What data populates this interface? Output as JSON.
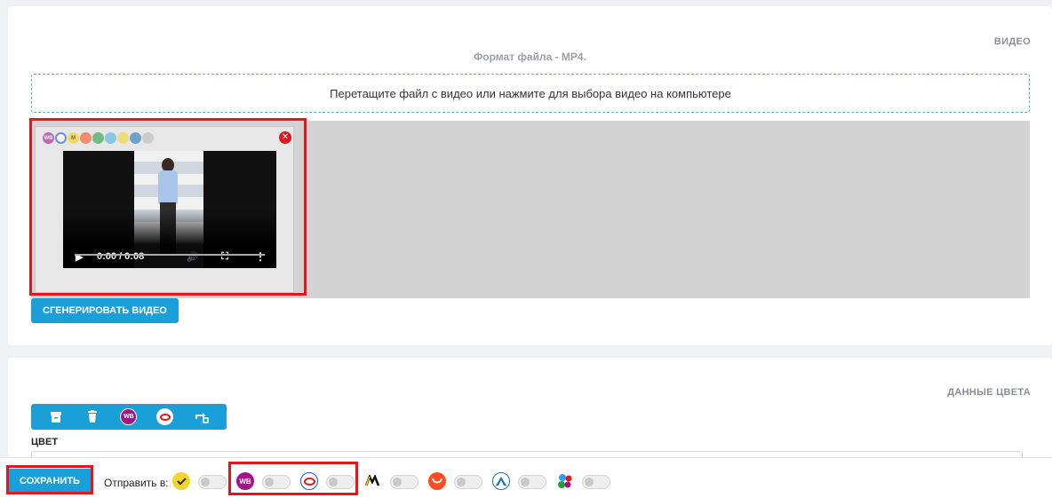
{
  "video_section": {
    "title": "ВИДЕО",
    "format_hint": "Формат файла - MP4.",
    "dropzone_text": "Перетащите файл с видео или нажмите для выбора видео на компьютере",
    "player": {
      "time": "0:00 / 0:08",
      "progress": 0
    },
    "generate_button": "СГЕНЕРИРОВАТЬ ВИДЕО",
    "thumb_marketplace_icons": [
      "wb",
      "ozon",
      "yandex-market",
      "aliexpress",
      "sber",
      "kazan",
      "lamoda",
      "megamarket",
      "other"
    ]
  },
  "color_section": {
    "title": "ДАННЫЕ ЦВЕТА",
    "color_label": "ЦВЕТ",
    "toolbar_icons": [
      "archive-icon",
      "trash-icon",
      "wildberries-icon",
      "ozon-icon",
      "swap-icon"
    ],
    "wb_text": "WB"
  },
  "bottom_bar": {
    "save_button": "СОХРАНИТЬ",
    "send_to_label": "Отправить в:",
    "marketplaces": [
      {
        "name": "sber",
        "color": "#f3d52b",
        "enabled": false
      },
      {
        "name": "wildberries",
        "color": "#a3118c",
        "text": "WB",
        "enabled": false
      },
      {
        "name": "ozon",
        "color": "#ffffff",
        "enabled": false
      },
      {
        "name": "yandex-market",
        "color": "#ffd100",
        "enabled": false
      },
      {
        "name": "aliexpress",
        "color": "#ff4b1f",
        "enabled": false
      },
      {
        "name": "lamoda",
        "color": "#ffffff",
        "enabled": false
      },
      {
        "name": "kazanexpress",
        "color": "#ffffff",
        "enabled": false
      }
    ]
  },
  "colors": {
    "accent": "#1a9fd8",
    "highlight": "#e3161e",
    "section_title": "#8a8f99"
  }
}
